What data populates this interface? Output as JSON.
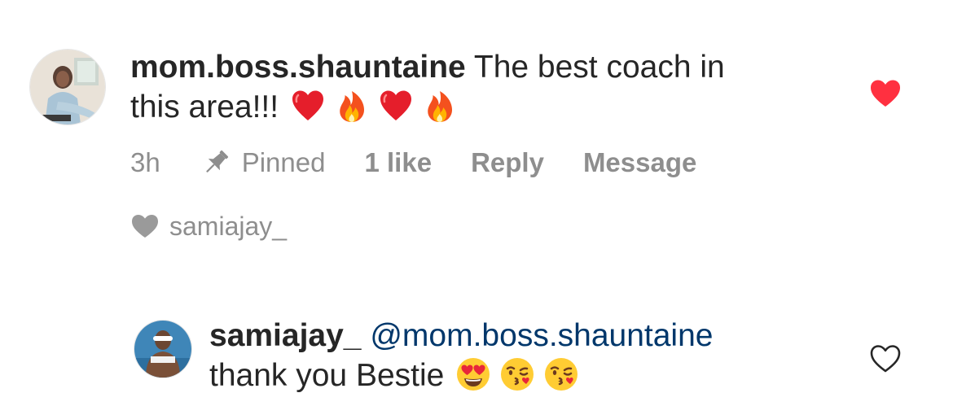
{
  "comment": {
    "username": "mom.boss.shauntaine",
    "text_line1": "The best coach in",
    "text_line2": "this area!!!",
    "emojis": [
      "red-heart-emoji",
      "fire-emoji",
      "red-heart-emoji",
      "fire-emoji"
    ],
    "liked_by_viewer": true,
    "meta": {
      "time": "3h",
      "pinned_label": "Pinned",
      "likes_label": "1 like",
      "reply_label": "Reply",
      "message_label": "Message"
    },
    "liked_by_author": {
      "icon": "heart-icon",
      "username": "samiajay_"
    }
  },
  "reply": {
    "username": "samiajay_",
    "mention": "@mom.boss.shauntaine",
    "text": "thank you Bestie",
    "emojis": [
      "heart-eyes-emoji",
      "kissing-face-emoji",
      "kissing-face-emoji"
    ],
    "liked_by_viewer": false
  },
  "colors": {
    "text": "#262626",
    "secondary": "#8e8e8e",
    "like_active": "#ff3040",
    "mention": "#00376b"
  }
}
